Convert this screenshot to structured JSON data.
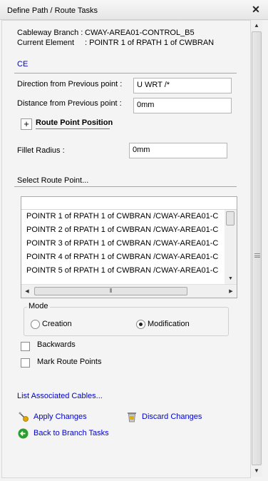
{
  "window": {
    "title": "Define Path / Route Tasks"
  },
  "info": {
    "branch_label": "Cableway Branch :",
    "branch_value": "CWAY-AREA01-CONTROL_B5",
    "element_label": "Current Element",
    "element_value": ": POINTR 1 of RPATH 1 of CWBRAN"
  },
  "ce_link": "CE",
  "direction": {
    "label": "Direction from Previous point :",
    "value": "U WRT /*"
  },
  "distance": {
    "label": "Distance from Previous point :",
    "value": "0mm"
  },
  "route_point_position": {
    "expander": "+",
    "label": "Route Point Position"
  },
  "fillet": {
    "label": "Fillet Radius :",
    "value": "0mm"
  },
  "select_route_point": {
    "label": "Select Route Point...",
    "items": [
      "POINTR 1 of RPATH 1 of CWBRAN /CWAY-AREA01-C",
      "POINTR 2 of RPATH 1 of CWBRAN /CWAY-AREA01-C",
      "POINTR 3 of RPATH 1 of CWBRAN /CWAY-AREA01-C",
      "POINTR 4 of RPATH 1 of CWBRAN /CWAY-AREA01-C",
      "POINTR 5 of RPATH 1 of CWBRAN /CWAY-AREA01-C"
    ]
  },
  "mode": {
    "label": "Mode",
    "options": [
      "Creation",
      "Modification"
    ],
    "selected": "Modification"
  },
  "backwards": {
    "label": "Backwards",
    "checked": false
  },
  "mark_route_points": {
    "label": "Mark Route Points",
    "checked": false
  },
  "links": {
    "list_cables": "List Associated Cables...",
    "apply": "Apply Changes",
    "discard": "Discard Changes",
    "back": "Back to Branch Tasks"
  },
  "colors": {
    "link": "#0000cc",
    "apply_icon": "#d6a400",
    "back_icon": "#2e9c2e"
  },
  "icons": {
    "close": "close-icon",
    "apply": "magic-wand-icon",
    "discard": "trash-bin-icon",
    "back": "back-arrow-icon"
  }
}
